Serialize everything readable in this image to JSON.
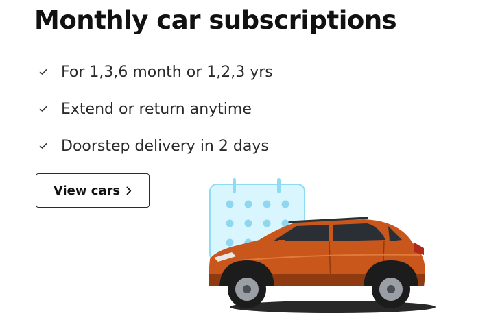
{
  "title": "Monthly car subscriptions",
  "features": [
    {
      "text": "For 1,3,6 month or 1,2,3 yrs",
      "icon": "check-icon"
    },
    {
      "text": "Extend or return anytime",
      "icon": "check-icon"
    },
    {
      "text": "Doorstep delivery in 2 days",
      "icon": "check-icon"
    }
  ],
  "cta": {
    "label": "View cars",
    "icon": "chevron-right-icon"
  },
  "illustration": {
    "calendar_icon": "calendar-icon",
    "car_image": "car-image",
    "colors": {
      "calendar_fill": "#d9f5fd",
      "calendar_border": "#8fdcf2",
      "calendar_dot": "#8fd7f0",
      "car_body": "#c9561a",
      "car_body_shadow": "#8f3a10",
      "glass": "#2a2f36",
      "tyre": "#1c1c1c"
    }
  },
  "colors": {
    "text": "#111111",
    "button_border": "#2b2b2b",
    "background": "#ffffff"
  }
}
